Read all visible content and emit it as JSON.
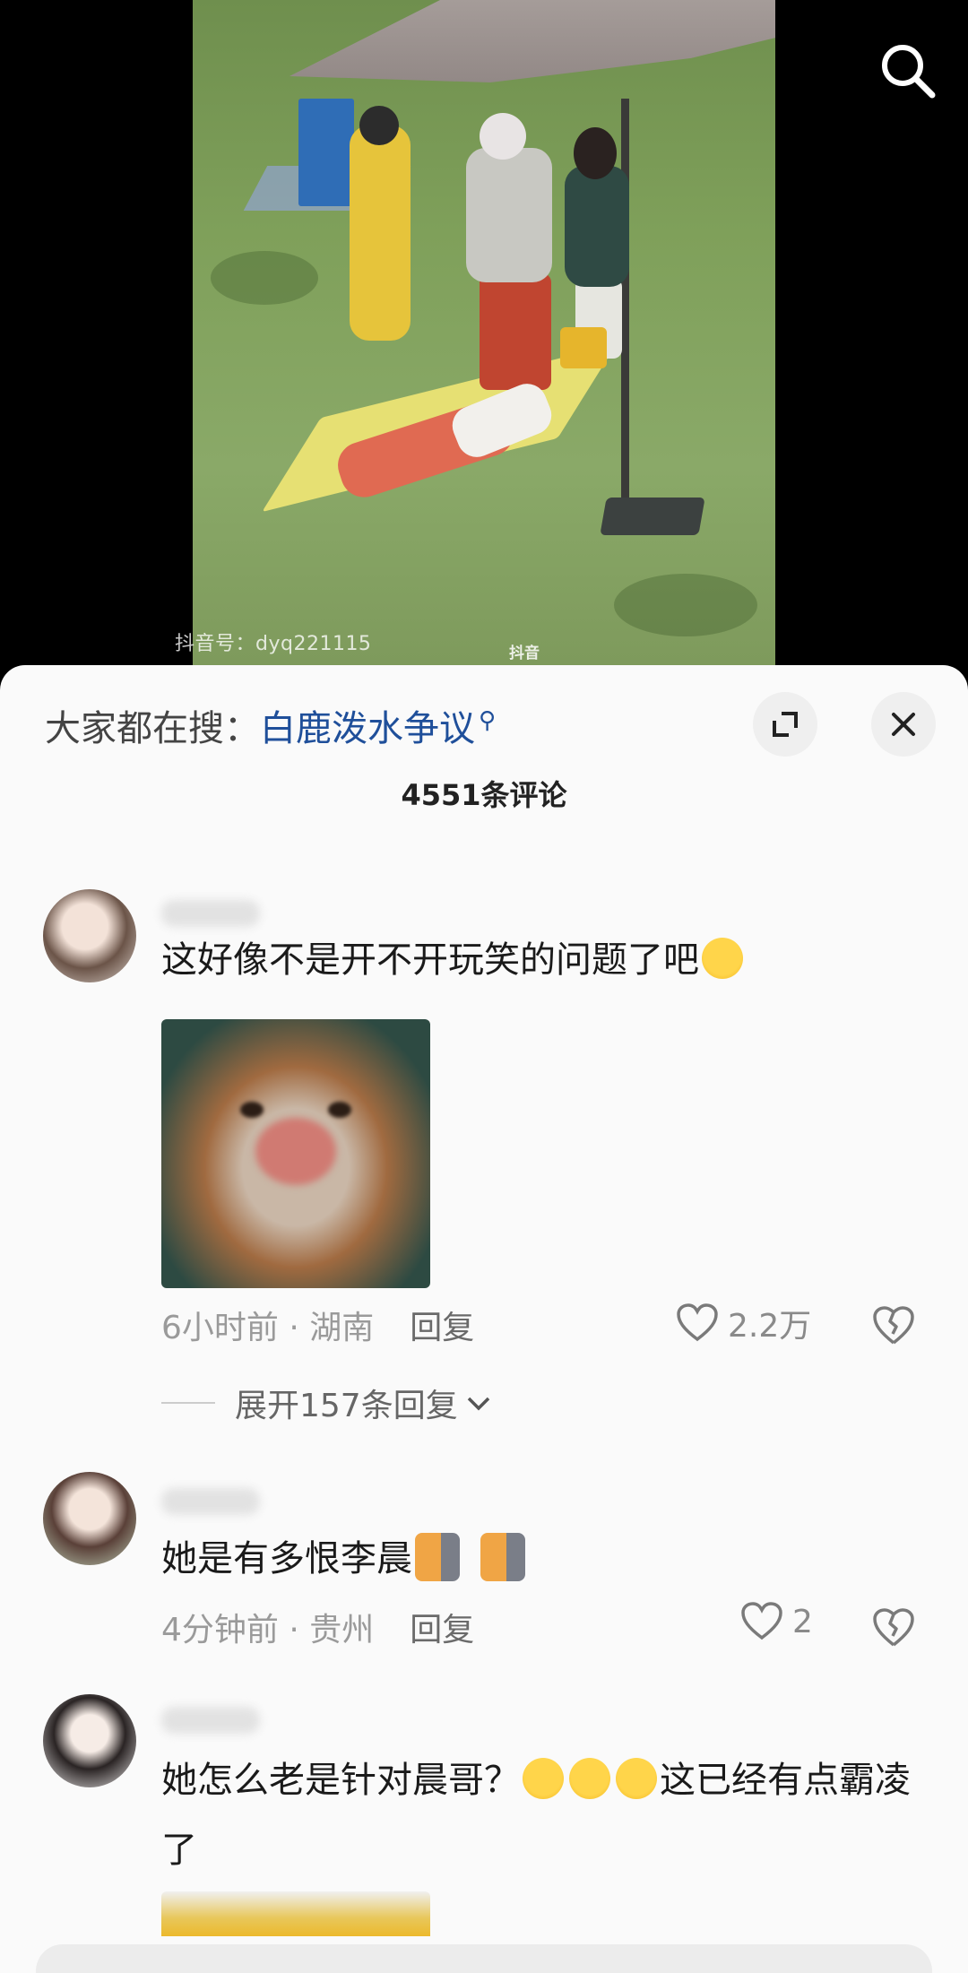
{
  "video": {
    "watermark": "抖音号：dyq221115",
    "logo_text": "抖音"
  },
  "sheet": {
    "trending_label": "大家都在搜：",
    "trending_term": "白鹿泼水争议",
    "comment_count": "4551条评论"
  },
  "comments": [
    {
      "text": "这好像不是开不开玩笑的问题了吧",
      "time": "6小时前",
      "location": "湖南",
      "reply": "回复",
      "likes": "2.2万",
      "expand_replies": "展开157条回复"
    },
    {
      "text": "她是有多恨李晨",
      "time": "4分钟前",
      "location": "贵州",
      "reply": "回复",
      "likes": "2"
    },
    {
      "text_part1": "她怎么老是针对晨哥？",
      "text_part2": "这已经有点霸凌了"
    }
  ],
  "meta_separator": " · ",
  "icons": {
    "search": "search-icon",
    "expand": "expand-icon",
    "close": "close-icon",
    "like": "heart-icon",
    "dislike": "broken-heart-icon",
    "chevron": "chevron-down-icon"
  }
}
